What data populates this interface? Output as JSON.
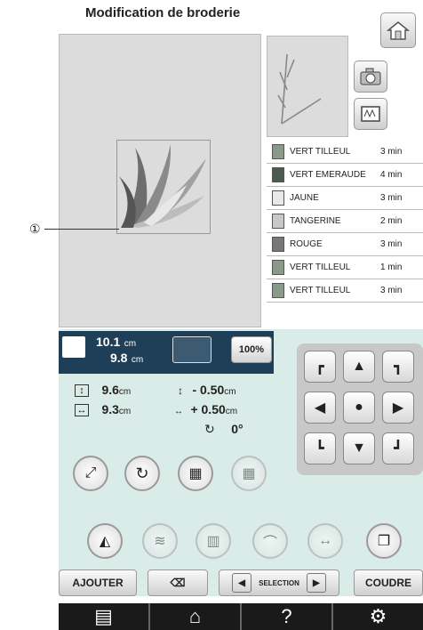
{
  "header": {
    "title": "Modification de broderie"
  },
  "callout": {
    "label": "①"
  },
  "threads": [
    {
      "name": "VERT TILLEUL",
      "time": "3 min",
      "color": "#8a9a88"
    },
    {
      "name": "VERT EMERAUDE",
      "time": "4 min",
      "color": "#4a5a4e"
    },
    {
      "name": "JAUNE",
      "time": "3 min",
      "color": "#e8e8e8"
    },
    {
      "name": "TANGERINE",
      "time": "2 min",
      "color": "#c8c8c8"
    },
    {
      "name": "ROUGE",
      "time": "3 min",
      "color": "#777777"
    },
    {
      "name": "VERT TILLEUL",
      "time": "1 min",
      "color": "#8a9a88"
    },
    {
      "name": "VERT TILLEUL",
      "time": "3 min",
      "color": "#8a9a88"
    }
  ],
  "size": {
    "width": "10.1",
    "height": "9.8",
    "unit": "cm",
    "zoom": "100%"
  },
  "position": {
    "v_size": "9.6",
    "h_size": "9.3",
    "unit": "cm",
    "v_offset": "- 0.50",
    "h_offset": "+ 0.50",
    "rotation": "0°"
  },
  "buttons": {
    "add": "AJOUTER",
    "selection": "SELECTION",
    "sew": "COUDRE"
  }
}
